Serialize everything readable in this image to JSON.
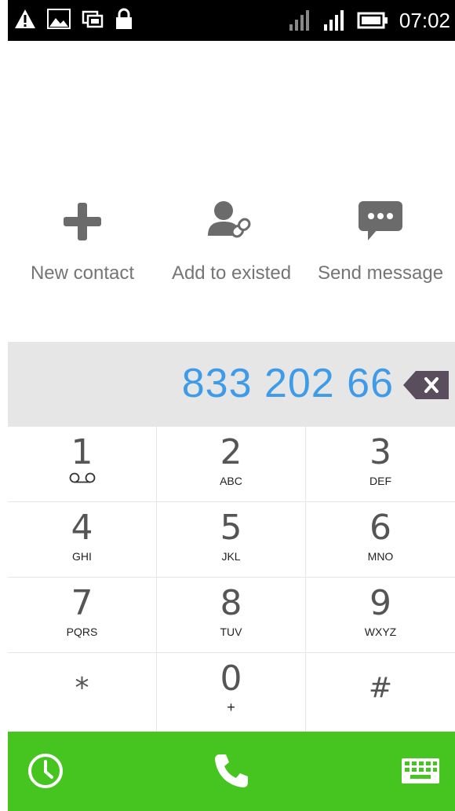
{
  "status_bar": {
    "time": "07:02",
    "icons": [
      "warning-icon",
      "image-icon",
      "screen-cast-icon",
      "lock-icon",
      "signal-icon",
      "signal-icon",
      "battery-icon"
    ]
  },
  "actions": [
    {
      "label": "New contact",
      "icon": "plus-icon"
    },
    {
      "label": "Add to existed",
      "icon": "add-to-contact-icon"
    },
    {
      "label": "Send message",
      "icon": "message-icon"
    }
  ],
  "dialed_number": "833 202 66",
  "keypad": [
    {
      "digit": "1",
      "letters": ""
    },
    {
      "digit": "2",
      "letters": "ABC"
    },
    {
      "digit": "3",
      "letters": "DEF"
    },
    {
      "digit": "4",
      "letters": "GHI"
    },
    {
      "digit": "5",
      "letters": "JKL"
    },
    {
      "digit": "6",
      "letters": "MNO"
    },
    {
      "digit": "7",
      "letters": "PQRS"
    },
    {
      "digit": "8",
      "letters": "TUV"
    },
    {
      "digit": "9",
      "letters": "WXYZ"
    },
    {
      "digit": "*",
      "letters": ""
    },
    {
      "digit": "0",
      "letters": "+"
    },
    {
      "digit": "#",
      "letters": ""
    }
  ],
  "bottom_bar": {
    "left_icon": "clock-icon",
    "center_icon": "phone-icon",
    "right_icon": "keyboard-icon"
  },
  "colors": {
    "accent_number": "#3d9be9",
    "bottom_bar": "#46c41f",
    "icon_gray": "#757575",
    "backspace": "#5a4d5e"
  }
}
